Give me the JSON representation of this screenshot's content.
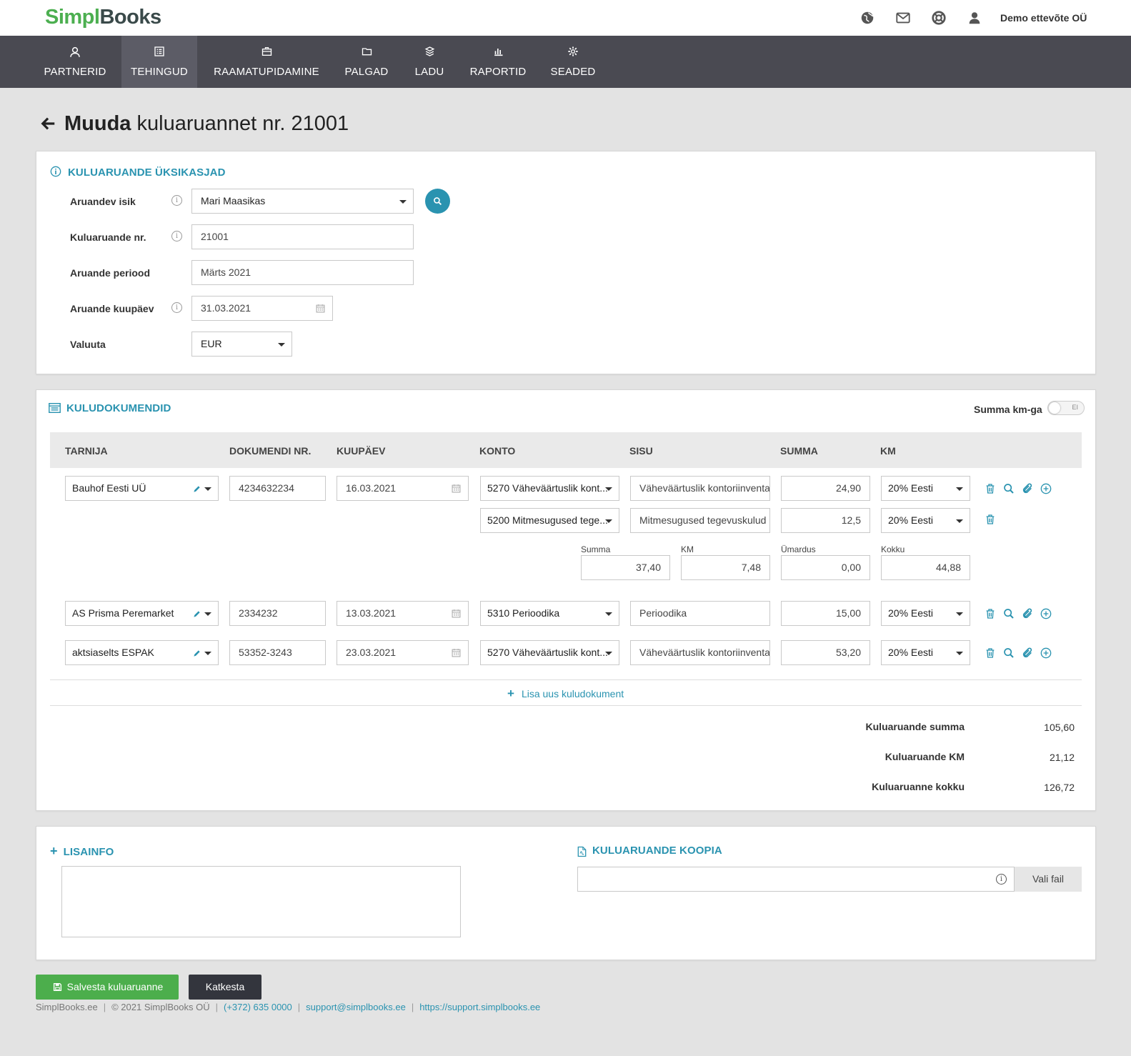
{
  "brand": {
    "part1": "Simpl",
    "part2": "Books"
  },
  "topbar": {
    "company": "Demo ettevõte OÜ",
    "icons": [
      "globe-icon",
      "mail-icon",
      "lifebuoy-icon",
      "user-icon"
    ]
  },
  "nav": [
    {
      "label": "PARTNERID",
      "icon": "user-outline-icon"
    },
    {
      "label": "TEHINGUD",
      "icon": "list-icon",
      "active": true
    },
    {
      "label": "RAAMATUPIDAMINE",
      "icon": "briefcase-icon"
    },
    {
      "label": "PALGAD",
      "icon": "folder-icon"
    },
    {
      "label": "LADU",
      "icon": "boxes-icon"
    },
    {
      "label": "RAPORTID",
      "icon": "bar-chart-icon"
    },
    {
      "label": "SEADED",
      "icon": "gear-icon"
    }
  ],
  "page": {
    "title_bold": "Muuda",
    "title_rest": "kuluaruannet nr. 21001"
  },
  "details": {
    "heading": "KULUARUANDE ÜKSIKASJAD",
    "person_label": "Aruandev isik",
    "person_value": "Mari Maasikas",
    "number_label": "Kuluaruande nr.",
    "number_value": "21001",
    "period_label": "Aruande periood",
    "period_value": "Märts 2021",
    "date_label": "Aruande kuupäev",
    "date_value": "31.03.2021",
    "currency_label": "Valuuta",
    "currency_value": "EUR"
  },
  "docs": {
    "heading": "KULUDOKUMENDID",
    "toggle_label": "Summa km-ga",
    "toggle_state": "EI",
    "columns": [
      "TARNIJA",
      "DOKUMENDI NR.",
      "KUUPÄEV",
      "KONTO",
      "SISU",
      "SUMMA",
      "KM"
    ],
    "rows": [
      {
        "supplier": "Bauhof Eesti UÜ",
        "docnr": "4234632234",
        "date": "16.03.2021",
        "account": "5270 Väheväärtuslik kont...",
        "content": "Väheväärtuslik kontoriinventa",
        "sum": "24,90",
        "vat": "20% Eesti",
        "subline": {
          "account": "5200 Mitmesugused tege...",
          "content": "Mitmesugused tegevuskulud",
          "sum": "12,5",
          "vat": "20% Eesti"
        },
        "subtotals": {
          "sum_label": "Summa",
          "sum": "37,40",
          "km_label": "KM",
          "km": "7,48",
          "round_label": "Ümardus",
          "round": "0,00",
          "total_label": "Kokku",
          "total": "44,88"
        }
      },
      {
        "supplier": "AS Prisma Peremarket",
        "docnr": "2334232",
        "date": "13.03.2021",
        "account": "5310 Perioodika",
        "content": "Perioodika",
        "sum": "15,00",
        "vat": "20% Eesti"
      },
      {
        "supplier": "aktsiaselts ESPAK",
        "docnr": "53352-3243",
        "date": "23.03.2021",
        "account": "5270 Väheväärtuslik kont...",
        "content": "Väheväärtuslik kontoriinventa",
        "sum": "53,20",
        "vat": "20% Eesti"
      }
    ],
    "add_label": "Lisa uus kuludokument",
    "totals": [
      {
        "label": "Kuluaruande summa",
        "value": "105,60"
      },
      {
        "label": "Kuluaruande KM",
        "value": "21,12"
      },
      {
        "label": "Kuluaruanne kokku",
        "value": "126,72"
      }
    ]
  },
  "extra": {
    "heading": "LISAINFO",
    "copy_heading": "KULUARUANDE KOOPIA",
    "choose_file": "Vali fail"
  },
  "actions": {
    "save": "Salvesta kuluaruanne",
    "cancel": "Katkesta"
  },
  "footer": {
    "site": "SimplBooks.ee",
    "copyright": "© 2021 SimplBooks OÜ",
    "phone": "(+372) 635 0000",
    "email": "support@simplbooks.ee",
    "support_url": "https://support.simplbooks.ee"
  },
  "colors": {
    "accent": "#2a93b0",
    "nav_bg": "#4a4a52",
    "save_green": "#4cae4c",
    "cancel_dark": "#33353d"
  }
}
